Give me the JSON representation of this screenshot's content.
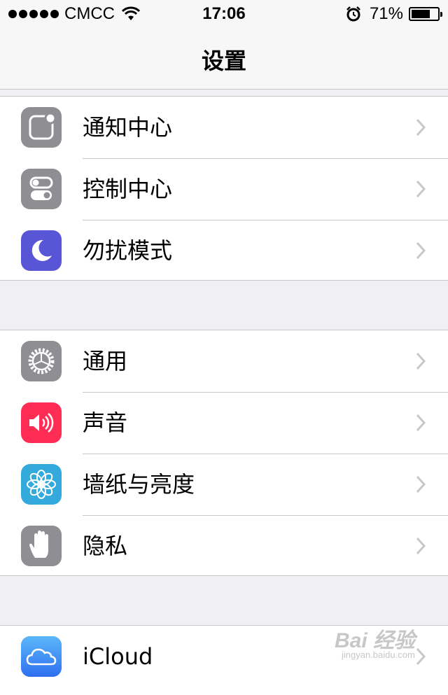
{
  "status_bar": {
    "carrier": "CMCC",
    "time": "17:06",
    "battery_percent_label": "71%",
    "battery_level": 0.71
  },
  "nav": {
    "title": "设置"
  },
  "groups": [
    {
      "items": [
        {
          "label": "通知中心",
          "icon": "notification-center-icon",
          "icon_color": "#8e8e93"
        },
        {
          "label": "控制中心",
          "icon": "control-center-icon",
          "icon_color": "#8e8e93"
        },
        {
          "label": "勿扰模式",
          "icon": "moon-icon",
          "icon_color": "#5856d6"
        }
      ]
    },
    {
      "items": [
        {
          "label": "通用",
          "icon": "gear-icon",
          "icon_color": "#8e8e93"
        },
        {
          "label": "声音",
          "icon": "speaker-icon",
          "icon_color": "#ff2d55"
        },
        {
          "label": "墙纸与亮度",
          "icon": "flower-icon",
          "icon_color": "#34aadc"
        },
        {
          "label": "隐私",
          "icon": "hand-icon",
          "icon_color": "#8e8e93"
        }
      ]
    },
    {
      "items": [
        {
          "label": "iCloud",
          "icon": "cloud-icon",
          "icon_color": "#2f7cf6"
        }
      ]
    }
  ],
  "watermark": {
    "brand": "Bai 经验",
    "url": "jingyan.baidu.com"
  },
  "colors": {
    "background": "#efeff4",
    "separator": "#c8c7cc",
    "chevron": "#c7c7cc"
  }
}
